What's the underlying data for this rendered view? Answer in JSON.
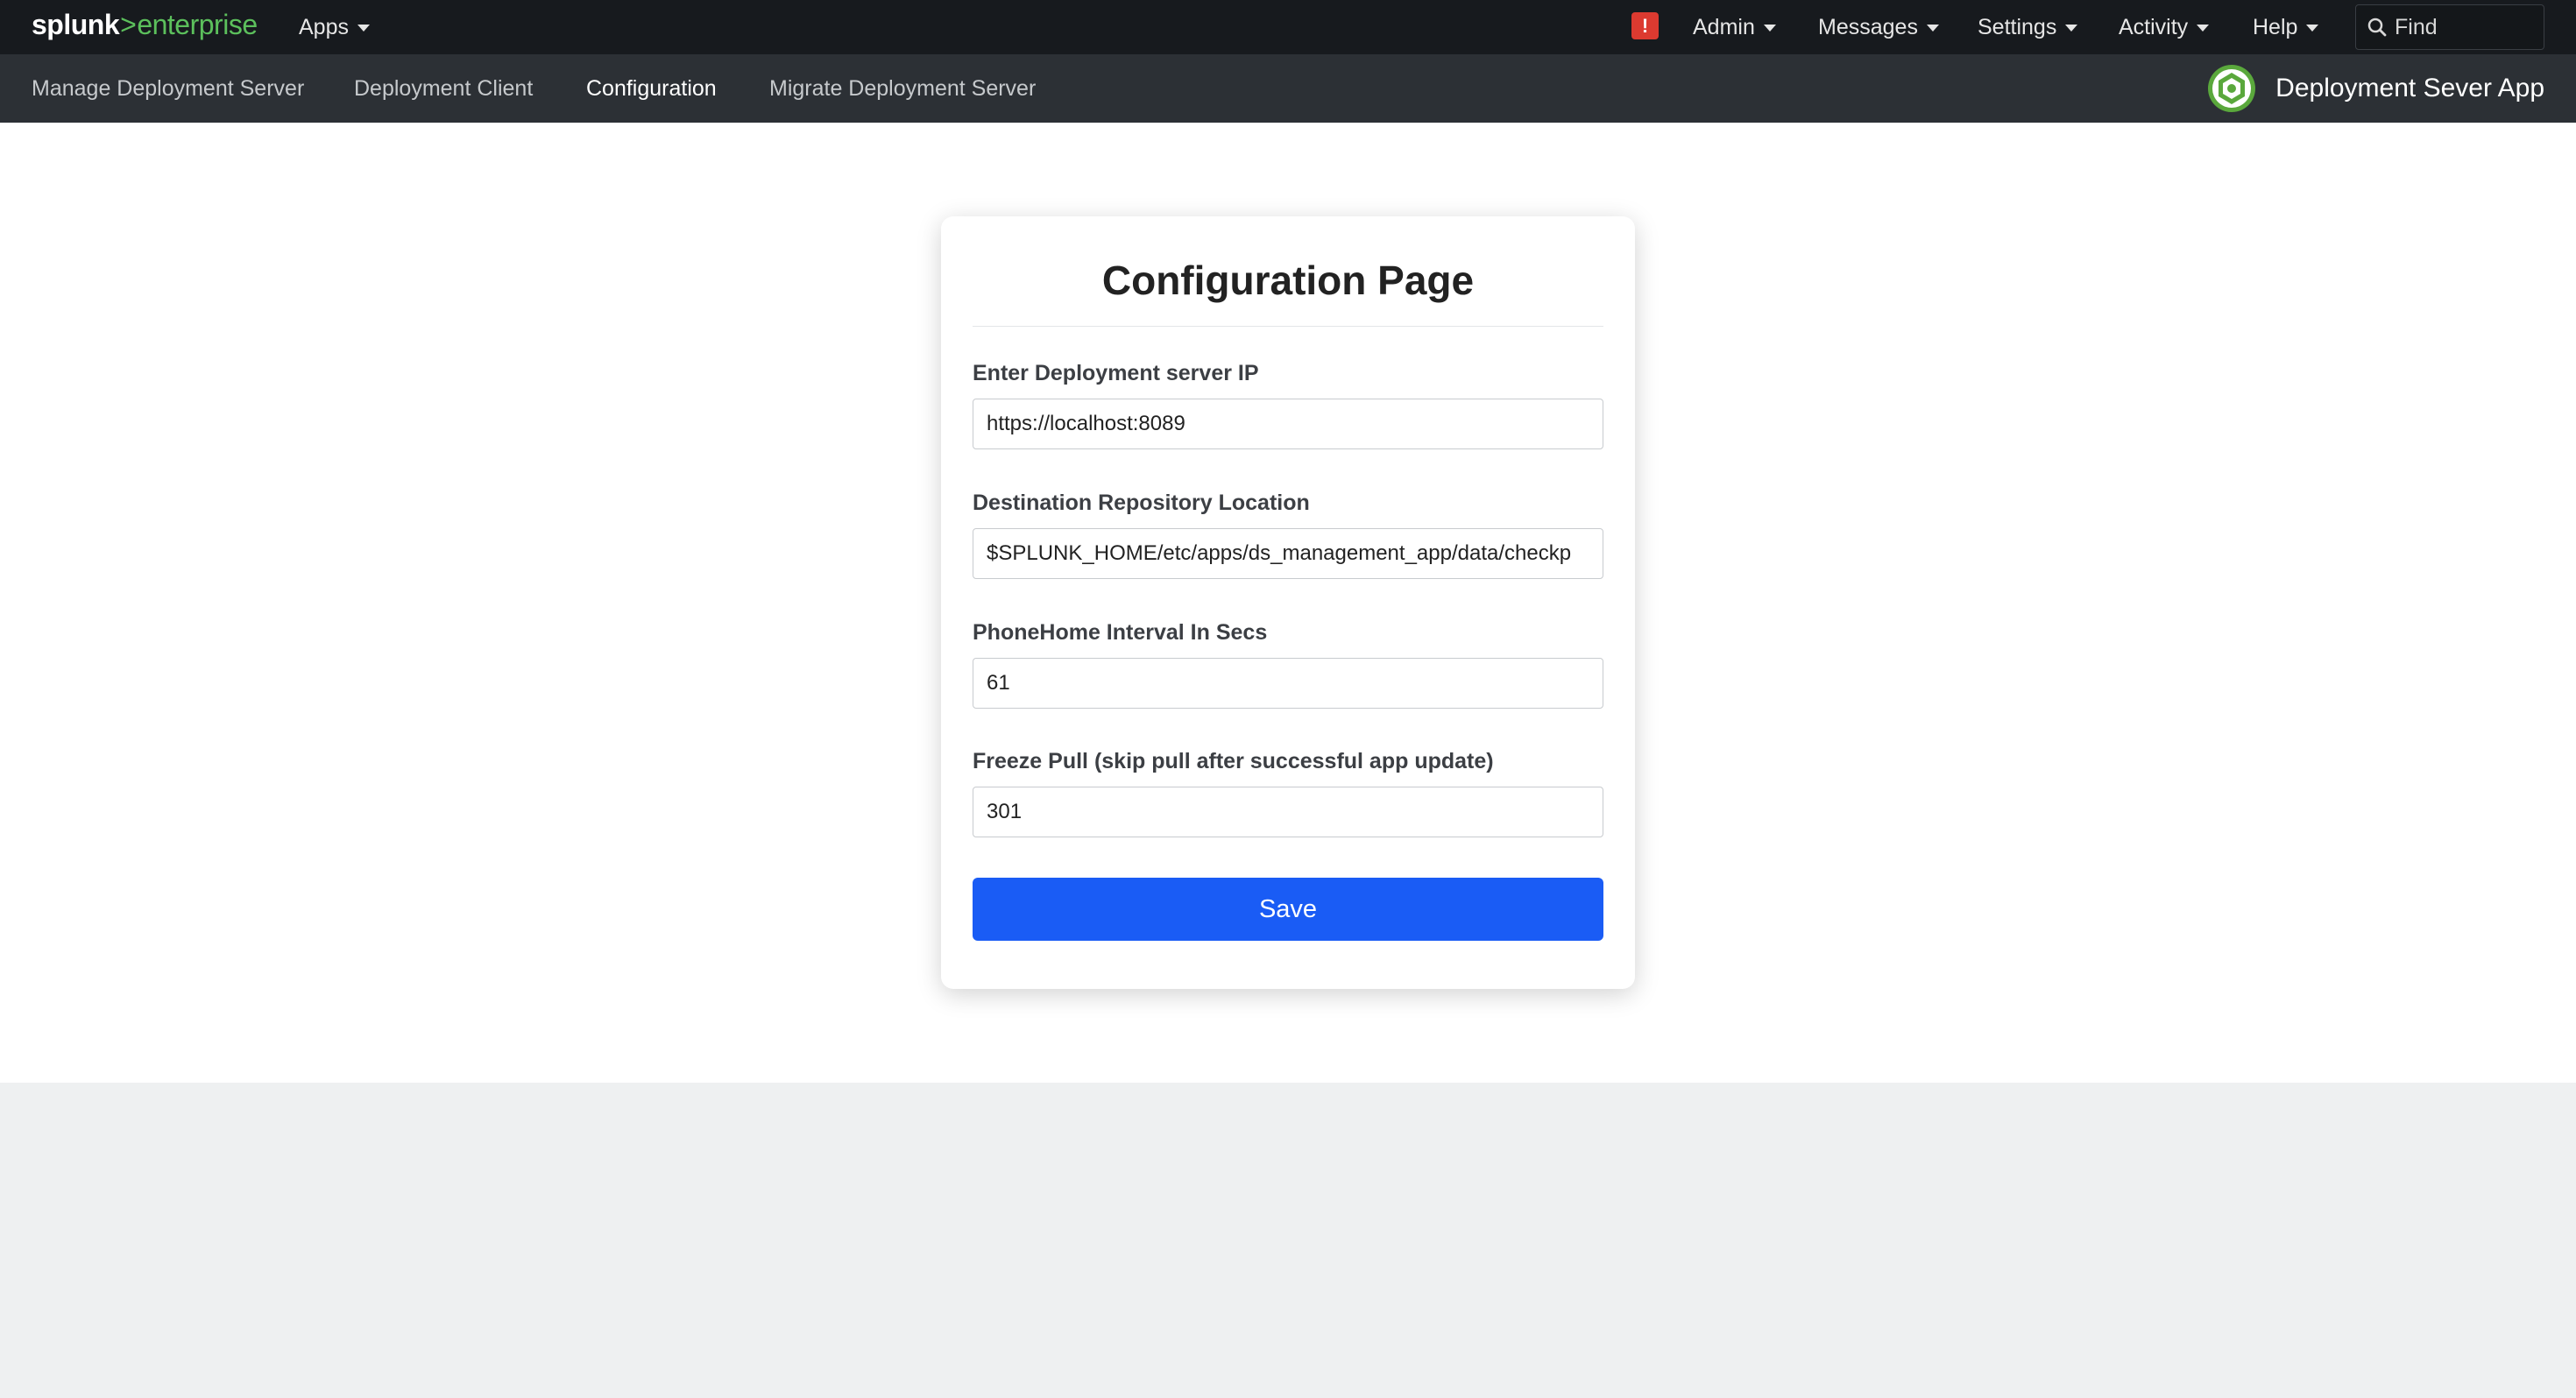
{
  "topbar": {
    "logo": {
      "brand": "splunk",
      "separator": ">",
      "product": "enterprise"
    },
    "apps_label": "Apps",
    "alert_badge": "!",
    "menus": {
      "admin": "Admin",
      "messages": "Messages",
      "settings": "Settings",
      "activity": "Activity",
      "help": "Help"
    },
    "find_placeholder": "Find"
  },
  "appbar": {
    "nav": {
      "manage": "Manage Deployment Server",
      "client": "Deployment Client",
      "configuration": "Configuration",
      "migrate": "Migrate Deployment Server"
    },
    "active_nav": "Configuration",
    "app_title": "Deployment Sever App"
  },
  "form": {
    "title": "Configuration Page",
    "server_ip": {
      "label": "Enter Deployment server IP",
      "value": "https://localhost:8089"
    },
    "repo_location": {
      "label": "Destination Repository Location",
      "value": "$SPLUNK_HOME/etc/apps/ds_management_app/data/checkp"
    },
    "phonehome": {
      "label": "PhoneHome Interval In Secs",
      "value": "61"
    },
    "freeze_pull": {
      "label": "Freeze Pull (skip pull after successful app update)",
      "value": "301"
    },
    "save_label": "Save"
  },
  "colors": {
    "topbar_bg": "#171a1e",
    "appbar_bg": "#2c3035",
    "brand_green": "#5cc05c",
    "alert_red": "#dc3a30",
    "primary_button": "#1a5cf5",
    "footer_bg": "#eef0f1"
  },
  "icons": [
    "search-icon",
    "alert-icon",
    "app-logo-icon",
    "chevron-down-icon"
  ]
}
